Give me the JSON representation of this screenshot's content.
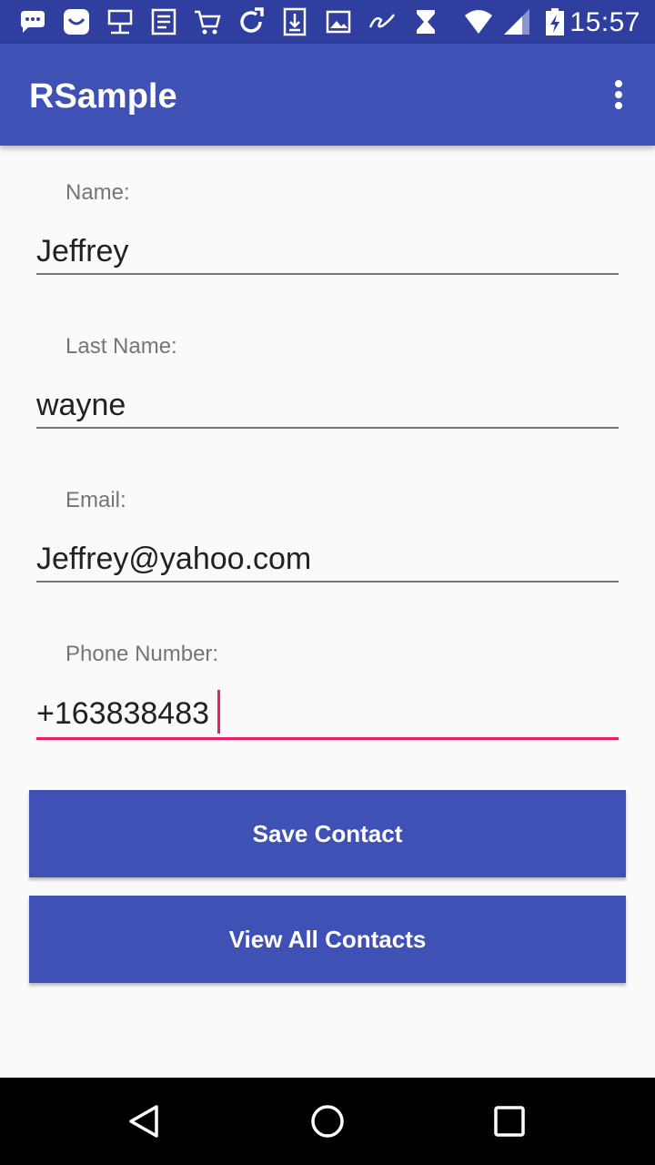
{
  "status_bar": {
    "time": "15:57",
    "icons": [
      "chat-icon",
      "smile-icon",
      "network-icon",
      "list-icon",
      "cart-icon",
      "sync-icon",
      "download-icon",
      "image-icon",
      "script-icon",
      "hourglass-icon",
      "wifi-icon",
      "signal-icon",
      "battery-icon"
    ]
  },
  "app_bar": {
    "title": "RSample",
    "menu_icon": "more-vert-icon"
  },
  "form": {
    "name_label": "Name:",
    "name_value": "Jeffrey",
    "last_name_label": "Last Name:",
    "last_name_value": "wayne",
    "email_label": "Email:",
    "email_value": "Jeffrey@yahoo.com",
    "phone_label": "Phone Number:",
    "phone_value": "+163838483"
  },
  "buttons": {
    "save": "Save Contact",
    "view_all": "View All Contacts"
  },
  "nav_bar": {
    "icons": [
      "back-icon",
      "home-icon",
      "recents-icon"
    ]
  },
  "colors": {
    "status_bar": "#303f9f",
    "primary": "#3f51b5",
    "accent": "#e91e63"
  }
}
